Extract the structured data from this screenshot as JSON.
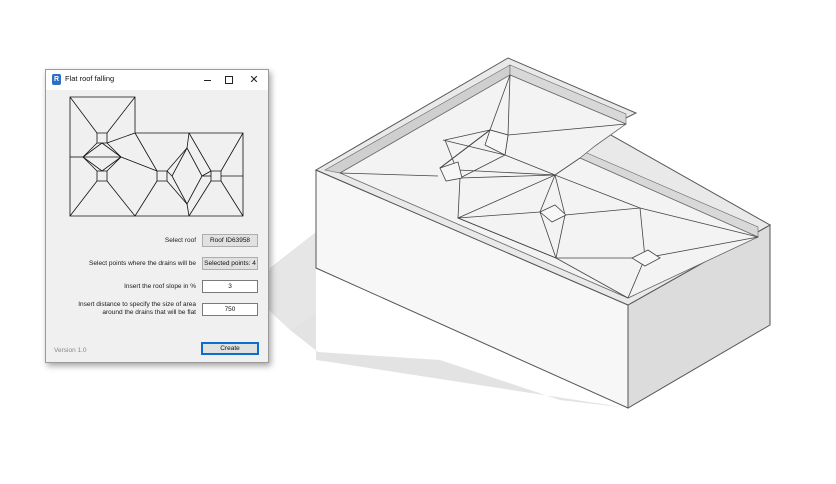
{
  "dialog": {
    "title": "Flat roof falling",
    "icon": "revit-app-icon",
    "controls": [
      "minimize-icon",
      "maximize-icon",
      "close-icon"
    ],
    "select_roof_label": "Select roof",
    "select_roof_value": "Roof ID63958",
    "select_points_label": "Select points where the drains will be",
    "select_points_value": "Selected points: 4",
    "slope_label": "Insert the roof slope in %",
    "slope_value": "3",
    "distance_label_line1": "Insert distance to specify the size of area",
    "distance_label_line2": "around the drains that will be flat",
    "distance_value": "750",
    "version": "Version 1.0",
    "create_label": "Create"
  },
  "colors": {
    "accent": "#0a6ecc",
    "app_icon": "#2b6fc7"
  }
}
